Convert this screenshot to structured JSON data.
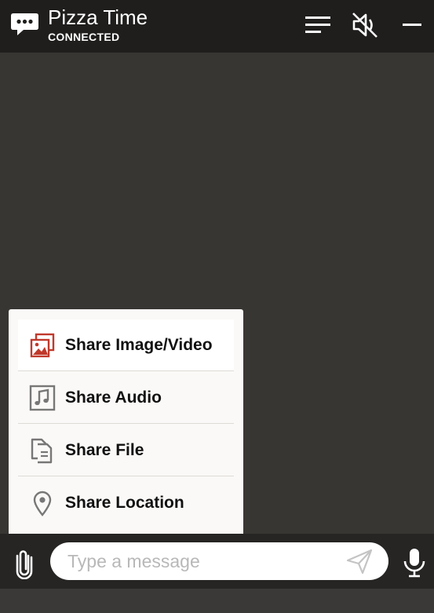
{
  "header": {
    "title": "Pizza Time",
    "status": "CONNECTED",
    "icons": {
      "chat": "chat-bubble-icon",
      "menu": "menu-icon",
      "mute": "speaker-muted-icon",
      "minimize": "minimize-icon"
    }
  },
  "share_menu": {
    "items": [
      {
        "label": "Share Image/Video",
        "icon": "image-icon",
        "highlighted": true
      },
      {
        "label": "Share Audio",
        "icon": "music-note-icon",
        "highlighted": false
      },
      {
        "label": "Share File",
        "icon": "file-icon",
        "highlighted": false
      },
      {
        "label": "Share Location",
        "icon": "location-pin-icon",
        "highlighted": false
      }
    ]
  },
  "composer": {
    "placeholder": "Type a message",
    "value": "",
    "icons": {
      "attach": "paperclip-icon",
      "send": "send-icon",
      "mic": "microphone-icon"
    }
  },
  "colors": {
    "header_bg": "#1f1e1d",
    "chat_bg": "#383633",
    "menu_bg": "#faf9f7",
    "accent": "#c0392b"
  }
}
